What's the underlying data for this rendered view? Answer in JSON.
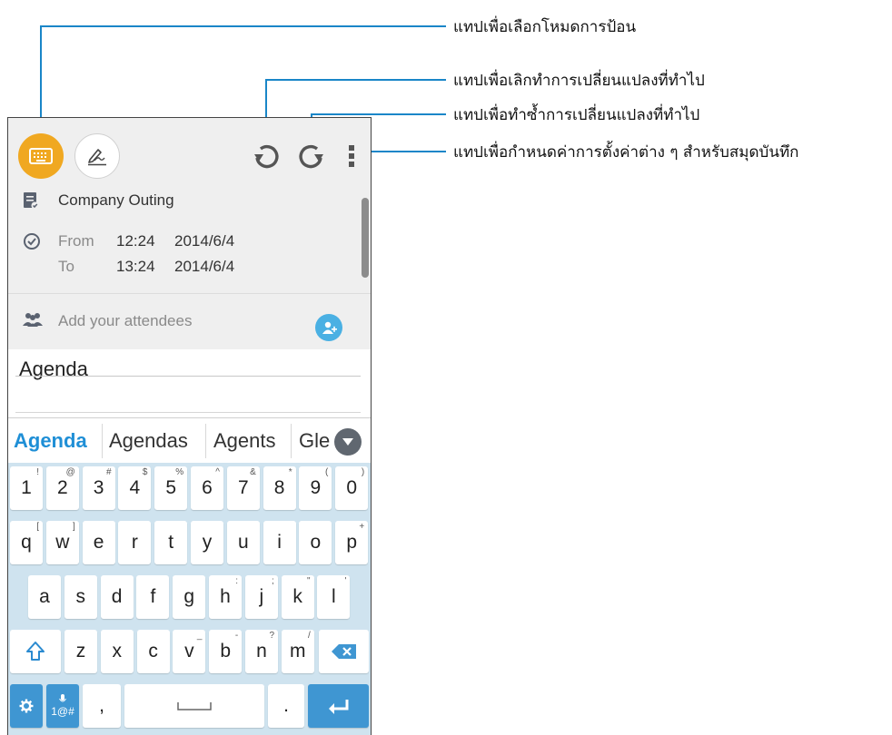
{
  "callouts": {
    "input_mode": "แทปเพื่อเลือกโหมดการป้อน",
    "undo": "แทปเพื่อเลิกทำการเปลี่ยนแปลงที่ทำไป",
    "redo": "แทปเพื่อทำซ้ำการเปลี่ยนแปลงที่ทำไป",
    "settings": "แทปเพื่อกำหนดค่าการตั้งค่าต่าง ๆ สำหรับสมุดบันทึก"
  },
  "colors": {
    "accent_orange": "#f0a821",
    "callout_blue": "#1a86c8",
    "key_blue": "#3f96d2",
    "suggest_blue": "#1f8fd6"
  },
  "toolbar": {
    "icons": [
      "keyboard-icon",
      "handwriting-icon",
      "undo-icon",
      "redo-icon",
      "more-vert-icon"
    ]
  },
  "event": {
    "title": "Company Outing",
    "from_label": "From",
    "from_time": "12:24",
    "from_date": "2014/6/4",
    "to_label": "To",
    "to_time": "13:24",
    "to_date": "2014/6/4",
    "attendees_placeholder": "Add your attendees"
  },
  "note": {
    "text": "Agenda"
  },
  "suggestions": [
    "Agenda",
    "Agendas",
    "Agents",
    "Gle"
  ],
  "keyboard": {
    "row1": [
      [
        "1",
        "!"
      ],
      [
        "2",
        "@"
      ],
      [
        "3",
        "#"
      ],
      [
        "4",
        "$"
      ],
      [
        "5",
        "%"
      ],
      [
        "6",
        "^"
      ],
      [
        "7",
        "&"
      ],
      [
        "8",
        "*"
      ],
      [
        "9",
        "("
      ],
      [
        "0",
        ")"
      ]
    ],
    "row2": [
      [
        "q",
        "["
      ],
      [
        "w",
        "]"
      ],
      [
        "e",
        ""
      ],
      [
        "r",
        ""
      ],
      [
        "t",
        ""
      ],
      [
        "y",
        ""
      ],
      [
        "u",
        ""
      ],
      [
        "i",
        ""
      ],
      [
        "o",
        ""
      ],
      [
        "p",
        "+"
      ]
    ],
    "row3": [
      [
        "a",
        ""
      ],
      [
        "s",
        ""
      ],
      [
        "d",
        ""
      ],
      [
        "f",
        ""
      ],
      [
        "g",
        ""
      ],
      [
        "h",
        ":"
      ],
      [
        "j",
        ";"
      ],
      [
        "k",
        "\""
      ],
      [
        "l",
        "'"
      ]
    ],
    "row4": [
      [
        "z",
        ""
      ],
      [
        "x",
        ""
      ],
      [
        "c",
        ""
      ],
      [
        "v",
        "_"
      ],
      [
        "b",
        "-"
      ],
      [
        "n",
        "?"
      ],
      [
        "m",
        "/"
      ]
    ],
    "sym_label": "1@#",
    "comma": ",",
    "period": "."
  }
}
